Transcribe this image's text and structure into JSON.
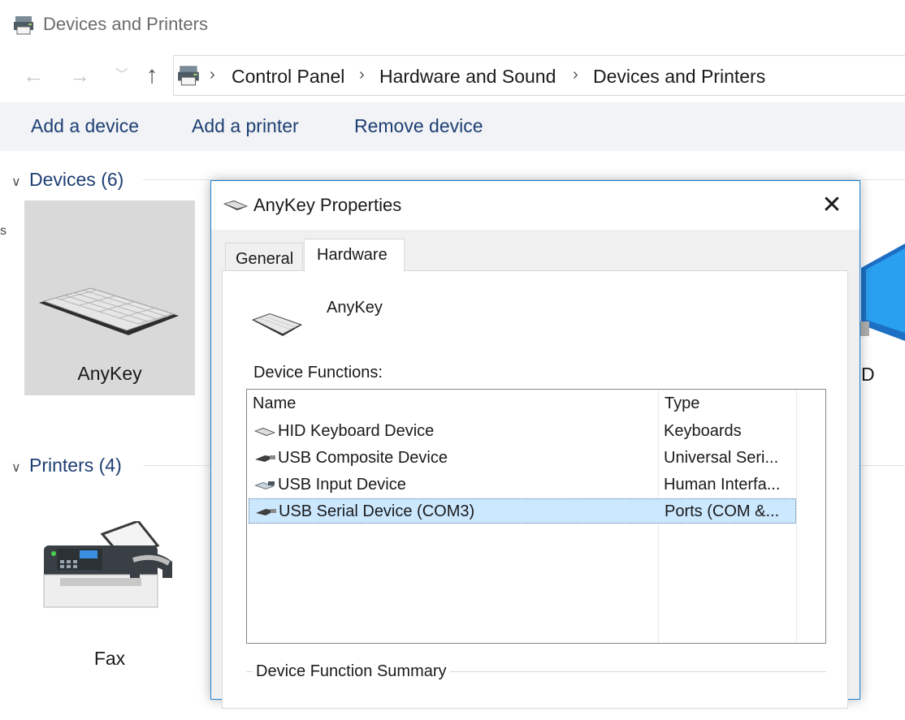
{
  "window": {
    "title": "Devices and Printers"
  },
  "address": {
    "crumbs": [
      "Control Panel",
      "Hardware and Sound",
      "Devices and Printers"
    ]
  },
  "commands": {
    "add_device": "Add a device",
    "add_printer": "Add a printer",
    "remove_device": "Remove device"
  },
  "groups": {
    "devices": {
      "label": "Devices (6)"
    },
    "printers": {
      "label": "Printers (4)"
    }
  },
  "devices": {
    "anykey": "AnyKey",
    "partial_right": "D"
  },
  "printers": {
    "fax": "Fax"
  },
  "dialog": {
    "title": "AnyKey Properties",
    "close_glyph": "✕",
    "tabs": {
      "general": "General",
      "hardware": "Hardware"
    },
    "device_name": "AnyKey",
    "functions_label": "Device Functions:",
    "columns": {
      "name": "Name",
      "type": "Type"
    },
    "rows": [
      {
        "name": "HID Keyboard Device",
        "type": "Keyboards",
        "icon": "keyboard-icon"
      },
      {
        "name": "USB Composite Device",
        "type": "Universal Seri...",
        "icon": "usb-icon"
      },
      {
        "name": "USB Input Device",
        "type": "Human Interfa...",
        "icon": "hid-icon"
      },
      {
        "name": "USB Serial Device (COM3)",
        "type": "Ports (COM &...",
        "icon": "usb-icon"
      }
    ],
    "selected_row": 3,
    "summary_label": "Device Function Summary"
  },
  "colors": {
    "link_blue": "#1e3f73",
    "selection": "#cce8ff",
    "dialog_border": "#1883d7"
  }
}
